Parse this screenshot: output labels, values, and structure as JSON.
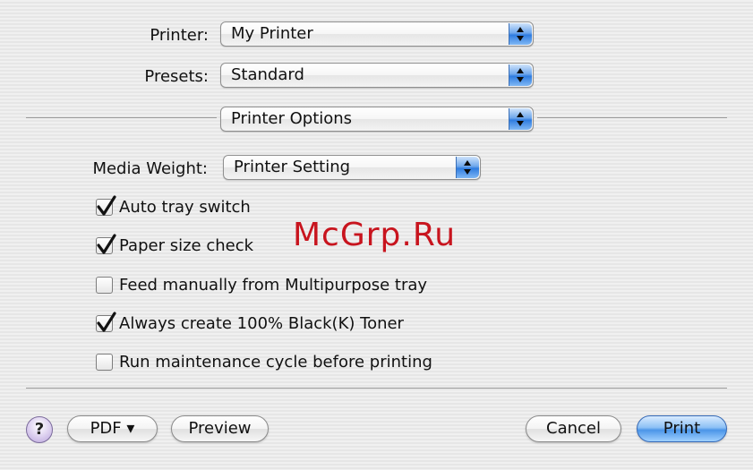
{
  "printer": {
    "label": "Printer:",
    "value": "My Printer"
  },
  "presets": {
    "label": "Presets:",
    "value": "Standard"
  },
  "section": {
    "value": "Printer Options"
  },
  "media_weight": {
    "label": "Media Weight:",
    "value": "Printer Setting"
  },
  "options": [
    {
      "label": "Auto tray switch",
      "checked": true
    },
    {
      "label": "Paper size check",
      "checked": true
    },
    {
      "label": "Feed manually from Multipurpose tray",
      "checked": false
    },
    {
      "label": "Always create 100% Black(K) Toner",
      "checked": true
    },
    {
      "label": "Run maintenance cycle before printing",
      "checked": false
    }
  ],
  "buttons": {
    "help": "?",
    "pdf": "PDF ▾",
    "preview": "Preview",
    "cancel": "Cancel",
    "print": "Print"
  },
  "watermark": "McGrp.Ru",
  "colors": {
    "accent_blue": "#2f7ce0",
    "watermark_red": "#c8141e"
  }
}
